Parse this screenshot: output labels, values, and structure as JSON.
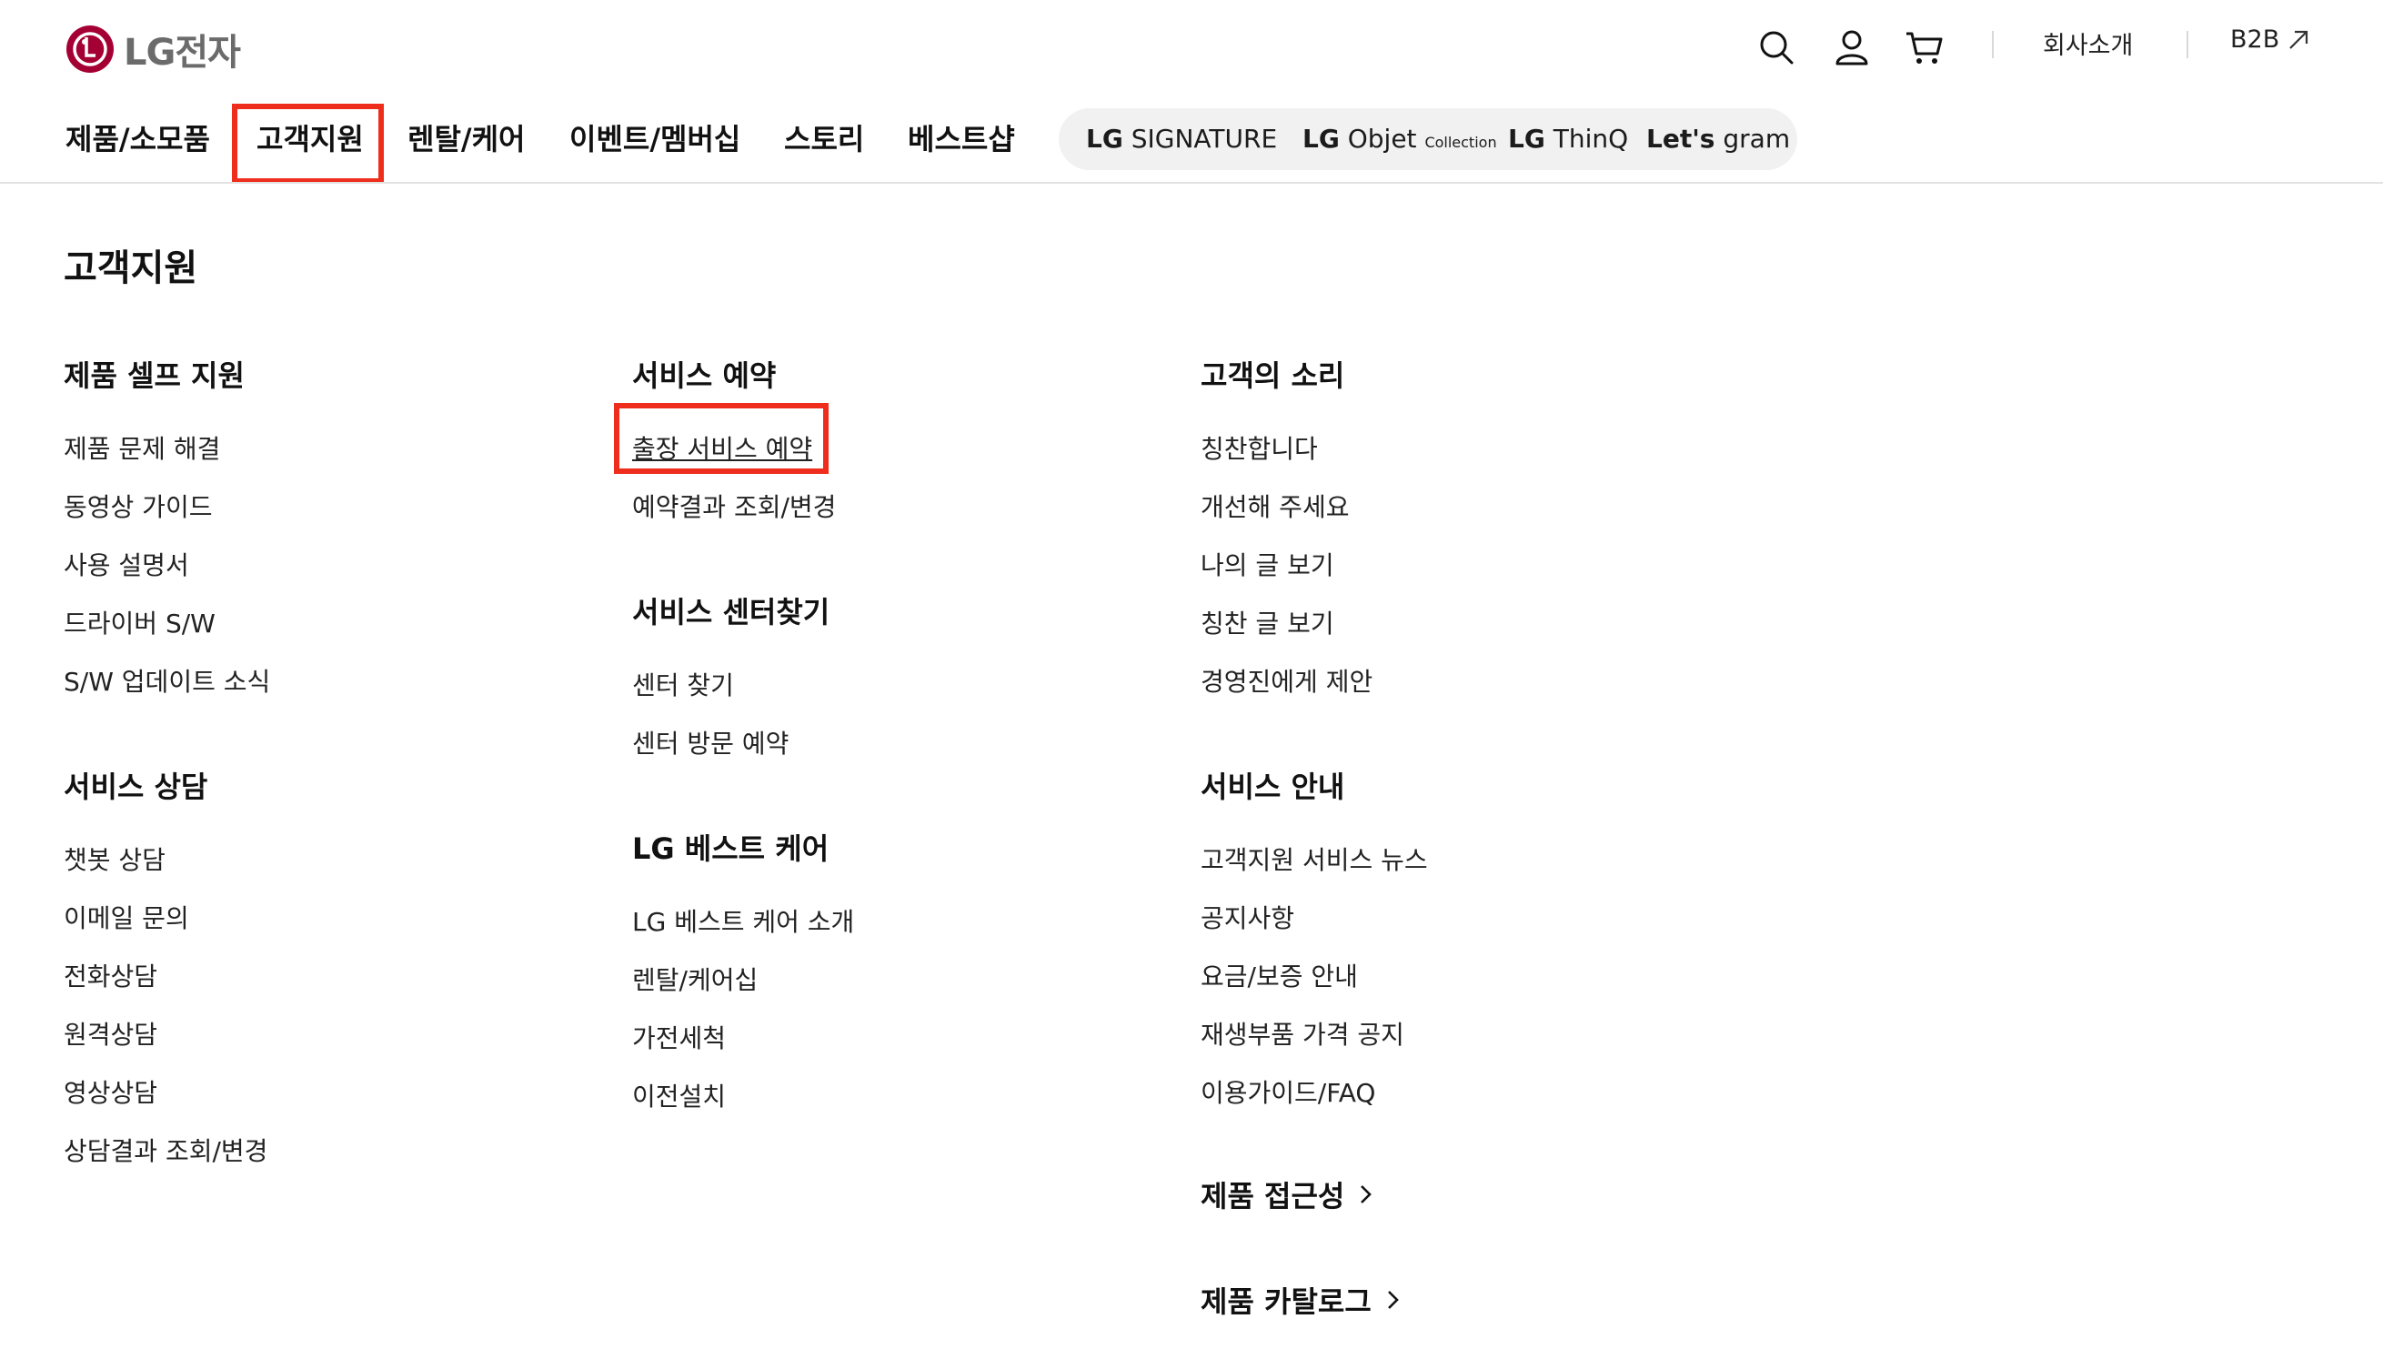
{
  "header": {
    "logo_text": "LG전자",
    "utility": {
      "company": "회사소개",
      "b2b": "B2B"
    }
  },
  "nav": {
    "items": [
      "제품/소모품",
      "고객지원",
      "렌탈/케어",
      "이벤트/멤버십",
      "스토리",
      "베스트샵"
    ],
    "active": "고객지원",
    "brands": {
      "signature_a": "LG",
      "signature_b": "SIGNATURE",
      "objet_a": "LG",
      "objet_b": "Objet",
      "objet_c": "Collection",
      "thinq_a": "LG",
      "thinq_b": "ThinQ",
      "gram_a": "Let's",
      "gram_b": "gram"
    }
  },
  "menu": {
    "title": "고객지원",
    "col1": {
      "self": {
        "heading": "제품 셀프 지원",
        "links": [
          "제품 문제 해결",
          "동영상 가이드",
          "사용 설명서",
          "드라이버 S/W",
          "S/W 업데이트 소식"
        ]
      },
      "consult": {
        "heading": "서비스 상담",
        "links": [
          "챗봇 상담",
          "이메일 문의",
          "전화상담",
          "원격상담",
          "영상상담",
          "상담결과 조회/변경"
        ]
      }
    },
    "col2": {
      "reserve": {
        "heading": "서비스 예약",
        "links": [
          "출장 서비스 예약",
          "예약결과 조회/변경"
        ]
      },
      "center": {
        "heading": "서비스 센터찾기",
        "links": [
          "센터 찾기",
          "센터 방문 예약"
        ]
      },
      "bestcare": {
        "heading": "LG 베스트 케어",
        "links": [
          "LG 베스트 케어 소개",
          "렌탈/케어십",
          "가전세척",
          "이전설치"
        ]
      }
    },
    "col3": {
      "voice": {
        "heading": "고객의 소리",
        "links": [
          "칭찬합니다",
          "개선해 주세요",
          "나의 글 보기",
          "칭찬 글 보기",
          "경영진에게 제안"
        ]
      },
      "guide": {
        "heading": "서비스 안내",
        "links": [
          "고객지원 서비스 뉴스",
          "공지사항",
          "요금/보증 안내",
          "재생부품 가격 공지",
          "이용가이드/FAQ"
        ]
      },
      "accessibility": "제품 접근성",
      "catalog": "제품 카탈로그"
    }
  },
  "colors": {
    "accent": "#ee2d1c",
    "brand_red": "#a50034"
  },
  "icons": [
    "search-icon",
    "user-icon",
    "cart-icon",
    "external-arrow-icon",
    "chevron-right-icon"
  ]
}
